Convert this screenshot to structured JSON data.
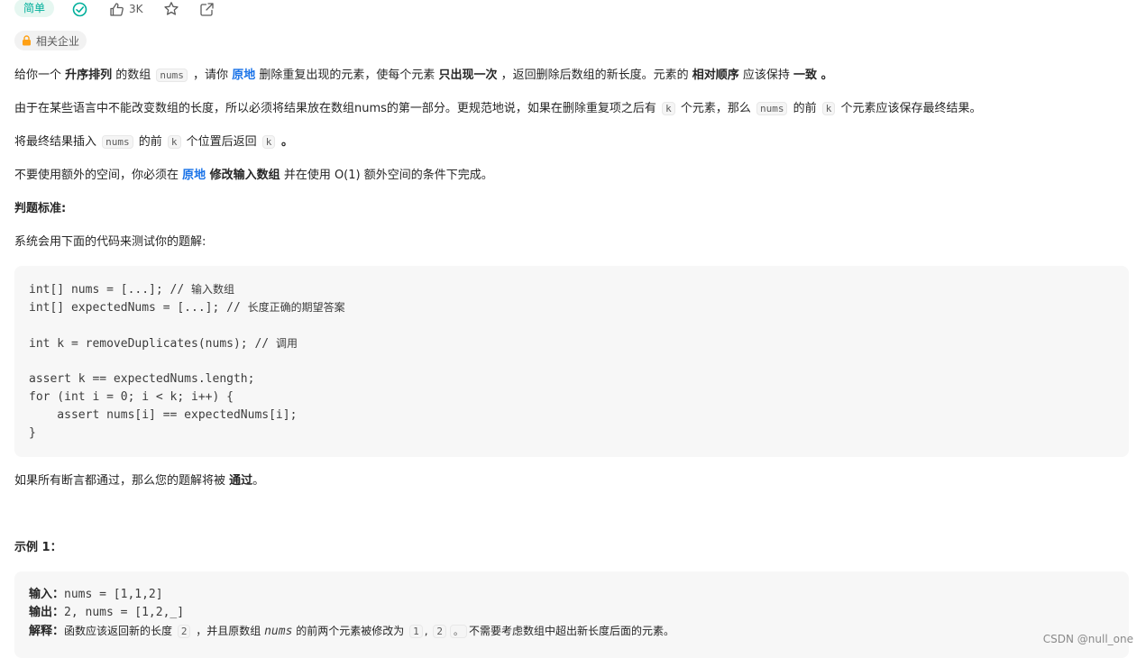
{
  "header": {
    "difficulty": "简单",
    "likes": "3K",
    "company_label": "相关企业"
  },
  "paragraphs": {
    "p1": {
      "t1": "给你一个 ",
      "b1": "升序排列",
      "t2": " 的数组 ",
      "code1": "nums",
      "t3": " ，请你 ",
      "link1": "原地",
      "t4": " 删除重复出现的元素，使每个元素 ",
      "b2": "只出现一次",
      "t5": " ，返回删除后数组的新长度。元素的 ",
      "b3": "相对顺序",
      "t6": " 应该保持 ",
      "b4": "一致",
      "t7": " 。"
    },
    "p2": {
      "t1": "由于在某些语言中不能改变数组的长度，所以必须将结果放在数组nums的第一部分。更规范地说，如果在删除重复项之后有 ",
      "code1": "k",
      "t2": " 个元素，那么 ",
      "code2": "nums",
      "t3": " 的前 ",
      "code3": "k",
      "t4": " 个元素应该保存最终结果。"
    },
    "p3": {
      "t1": "将最终结果插入 ",
      "code1": "nums",
      "t2": " 的前 ",
      "code2": "k",
      "t3": " 个位置后返回 ",
      "code3": "k",
      "t4": " 。"
    },
    "p4": {
      "t1": "不要使用额外的空间，你必须在 ",
      "link1": "原地",
      "b1": " 修改输入数组",
      "t2": " 并在使用 O(1) 额外空间的条件下完成。"
    },
    "judge_title": "判题标准:",
    "judge_desc": "系统会用下面的代码来测试你的题解:",
    "pass_t1": "如果所有断言都通过，那么您的题解将被 ",
    "pass_b1": "通过",
    "pass_t2": "。",
    "example_title": "示例 1："
  },
  "code_lines": [
    {
      "code": "int[] nums = [...]; // ",
      "cn": "输入数组"
    },
    {
      "code": "int[] expectedNums = [...]; // ",
      "cn": "长度正确的期望答案"
    },
    {
      "code": "",
      "cn": ""
    },
    {
      "code": "int k = removeDuplicates(nums); // ",
      "cn": "调用"
    },
    {
      "code": "",
      "cn": ""
    },
    {
      "code": "assert k == expectedNums.length;",
      "cn": ""
    },
    {
      "code": "for (int i = 0; i < k; i++) {",
      "cn": ""
    },
    {
      "code": "    assert nums[i] == expectedNums[i];",
      "cn": ""
    },
    {
      "code": "}",
      "cn": ""
    }
  ],
  "example": {
    "input_label": "输入：",
    "input_value": "nums = [1,1,2]",
    "output_label": "输出：",
    "output_value": "2, nums = [1,2,_]",
    "explain_label": "解释：",
    "explain_t1": "函数应该返回新的长度 ",
    "explain_c1": "2",
    "explain_t2": " ，并且原数组 ",
    "explain_it": "nums",
    "explain_t3": " 的前两个元素被修改为 ",
    "explain_c2": "1",
    "explain_t4": ", ",
    "explain_c3": "2",
    "explain_c4": "。",
    "explain_t5": "不需要考虑数组中超出新长度后面的元素。"
  },
  "watermark": "CSDN @null_one",
  "colors": {
    "easy_tag_bg": "#e6f7f1",
    "easy_tag_fg": "#00af9b",
    "accent_link": "#1a73e8",
    "code_bg": "#f7f7f7"
  },
  "icons": [
    "check-circle-icon",
    "thumb-up-icon",
    "star-icon",
    "share-icon",
    "lock-icon"
  ]
}
